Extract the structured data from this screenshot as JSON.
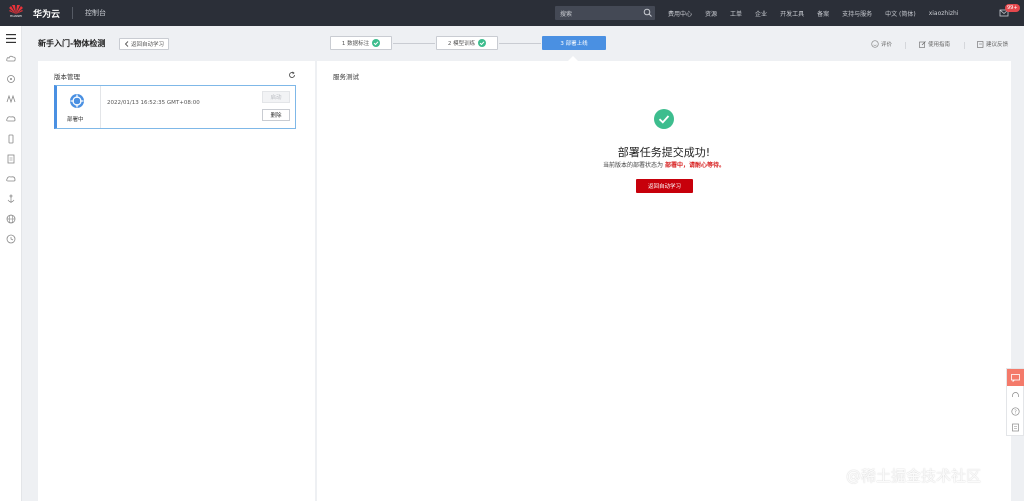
{
  "topbar": {
    "logo_text": "HUAWEI",
    "brand": "华为云",
    "console": "控制台",
    "search_placeholder": "搜索",
    "nav": [
      "费用中心",
      "资源",
      "工单",
      "企业",
      "开发工具",
      "备案",
      "支持与服务",
      "中文 (简体)",
      "xiaozhizhi"
    ],
    "badge": "99+"
  },
  "header": {
    "title": "新手入门-物体检测",
    "back_label": "返回自动学习",
    "steps": [
      {
        "label": "1 数据标注",
        "done": true
      },
      {
        "label": "2 模型训练",
        "done": true
      },
      {
        "label": "3 部署上线",
        "done": false
      }
    ],
    "links": {
      "rate": "评价",
      "guide": "使用指南",
      "feedback": "建议反馈"
    }
  },
  "version_panel": {
    "title": "版本管理",
    "card": {
      "status": "部署中",
      "time": "2022/01/13 16:52:35 GMT+08:00",
      "start_label": "启动",
      "delete_label": "删除"
    }
  },
  "service_panel": {
    "title": "服务测试",
    "success_title": "部署任务提交成功!",
    "status_prefix": "当前版本的部署状态为",
    "status_value": "部署中，请耐心等待。",
    "button_label": "返回自动学习"
  },
  "watermark": "@稀土掘金技术社区",
  "colors": {
    "accent": "#4a90e2",
    "success": "#3dbd8e",
    "primary_red": "#c7000b",
    "topbar": "#2b2f38"
  }
}
